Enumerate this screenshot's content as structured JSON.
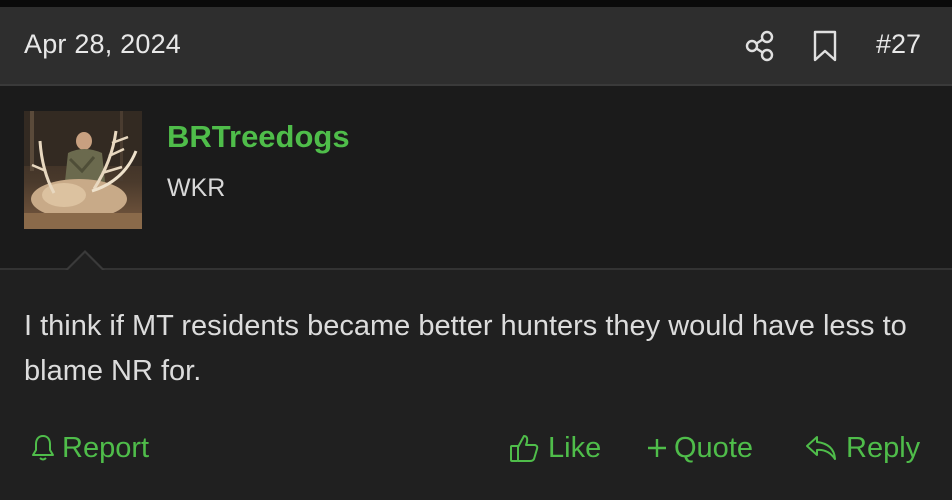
{
  "post": {
    "date": "Apr 28, 2024",
    "number": "#27",
    "share_icon": "share-icon",
    "bookmark_icon": "bookmark-icon"
  },
  "author": {
    "username": "BRTreedogs",
    "title": "WKR",
    "avatar": "hunter-with-elk-photo"
  },
  "message": {
    "text": "I think if MT residents became better hunters they would have less to blame NR for."
  },
  "actions": {
    "report": "Report",
    "like": "Like",
    "quote": "Quote",
    "reply": "Reply"
  },
  "colors": {
    "accent": "#4fbd4a",
    "header_bg": "#2e2e2e",
    "body_bg": "#202020",
    "page_bg": "#1b1b1b"
  }
}
